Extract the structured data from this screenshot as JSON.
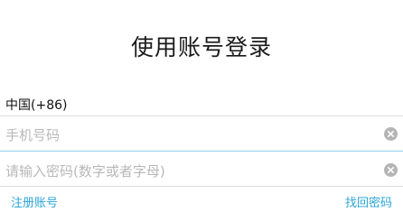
{
  "header": {
    "title": "使用账号登录"
  },
  "country": {
    "label": "中国(+86)"
  },
  "phone_input": {
    "placeholder": "手机号码"
  },
  "password_input": {
    "placeholder": "请输入密码(数字或者字母)"
  },
  "links": {
    "register": "注册账号",
    "recover_password": "找回密码"
  },
  "icons": {
    "clear": "clear-icon"
  },
  "colors": {
    "accent": "#2aa5d8",
    "focus_underline": "#8fd3ea",
    "placeholder": "#b8b8b8"
  }
}
